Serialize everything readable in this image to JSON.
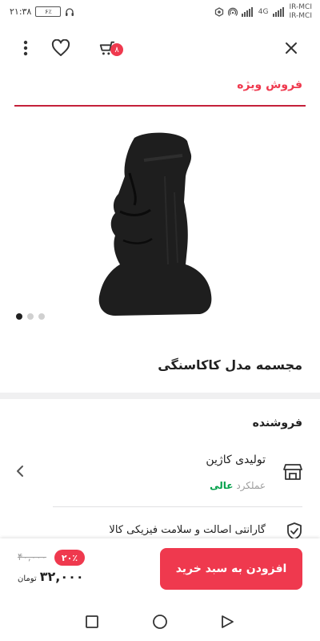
{
  "status_bar": {
    "time": "۲۱:۳۸",
    "battery": "۶٪",
    "carriers": [
      "IR-MCI",
      "IR-MCI"
    ],
    "network": "4G"
  },
  "header": {
    "cart_badge": "۸"
  },
  "special_sale_label": "فروش ویژه",
  "product": {
    "title": "مجسمه مدل کاکاسنگی",
    "image_count": 3,
    "active_image": 1
  },
  "seller": {
    "heading": "فروشنده",
    "name": "تولیدی کاژین",
    "performance_label": "عملکرد",
    "performance_value": "عالی"
  },
  "guarantee_text": "گارانتی اصالت و سلامت فیزیکی کالا",
  "purchase": {
    "add_to_cart_label": "افزودن به سبد خرید",
    "discount": "۲۰٪",
    "old_price": "۴۰,۰۰۰",
    "price": "۳۲,۰۰۰",
    "currency": "تومان"
  },
  "colors": {
    "accent": "#ef394e",
    "dark_accent": "#c4203a",
    "success": "#00a049"
  },
  "icons": [
    "close-icon",
    "cart-icon",
    "heart-icon",
    "more-vert-icon",
    "shop-icon",
    "chevron-left-icon",
    "shield-check-icon",
    "nav-recent-icon",
    "nav-home-icon",
    "nav-back-icon"
  ]
}
